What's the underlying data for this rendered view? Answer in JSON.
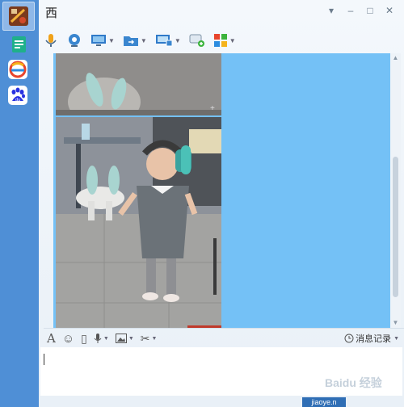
{
  "window": {
    "title": "西"
  },
  "window_controls": [
    "▾",
    "–",
    "□",
    "✕"
  ],
  "rail": {
    "items": [
      {
        "name": "game-app-icon",
        "active": true
      },
      {
        "name": "document-app-icon",
        "active": false
      },
      {
        "name": "colorful-e-app-icon",
        "active": false
      },
      {
        "name": "baidu-app-icon",
        "active": false
      }
    ]
  },
  "toolbar": {
    "items": [
      {
        "name": "voice-call-icon",
        "caret": false
      },
      {
        "name": "video-call-icon",
        "caret": false
      },
      {
        "name": "remote-desktop-icon",
        "caret": true
      },
      {
        "name": "send-file-icon",
        "caret": true
      },
      {
        "name": "screen-share-icon",
        "caret": true
      },
      {
        "name": "new-discussion-icon",
        "caret": false
      },
      {
        "name": "apps-icon",
        "caret": true
      }
    ]
  },
  "input_tools": {
    "items": [
      {
        "glyph": "A",
        "name": "font-icon",
        "caret": false
      },
      {
        "glyph": "☺",
        "name": "emoji-icon",
        "caret": false
      },
      {
        "glyph": "▯",
        "name": "shake-window-icon",
        "caret": false
      },
      {
        "glyph": "🎙",
        "name": "voice-message-icon",
        "caret": true
      },
      {
        "glyph": "▣",
        "name": "send-image-icon",
        "caret": true
      },
      {
        "glyph": "✂",
        "name": "screenshot-icon",
        "caret": true
      }
    ]
  },
  "history": {
    "label": "消息记录"
  },
  "send_button": {
    "label": "jiaoye.n"
  },
  "watermark": {
    "text": "Baidu 经验"
  },
  "colors": {
    "rail": "#4f8fd6",
    "chat_bubble_blue": "#74c1f6",
    "window_bg": "#eef3f8"
  }
}
